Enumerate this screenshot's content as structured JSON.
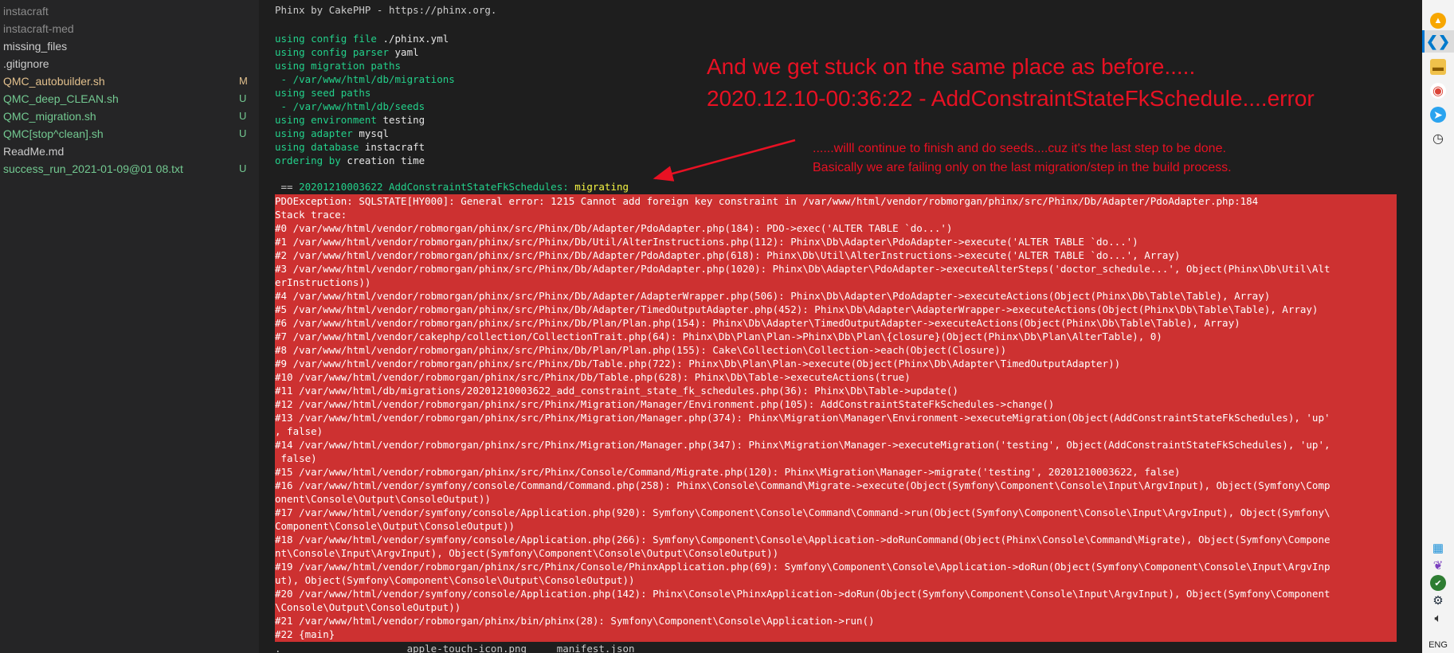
{
  "explorer": {
    "files": [
      {
        "name": "instacraft",
        "badge": "",
        "tone": "dim"
      },
      {
        "name": "instacraft-med",
        "badge": "",
        "tone": "dim"
      },
      {
        "name": "missing_files",
        "badge": "",
        "tone": "white"
      },
      {
        "name": ".gitignore",
        "badge": "",
        "tone": "white"
      },
      {
        "name": "QMC_autobuilder.sh",
        "badge": "M",
        "tone": "modified"
      },
      {
        "name": "QMC_deep_CLEAN.sh",
        "badge": "U",
        "tone": "untracked"
      },
      {
        "name": "QMC_migration.sh",
        "badge": "U",
        "tone": "untracked"
      },
      {
        "name": "QMC[stop^clean].sh",
        "badge": "U",
        "tone": "untracked"
      },
      {
        "name": "ReadMe.md",
        "badge": "",
        "tone": "white"
      },
      {
        "name": "success_run_2021-01-09@01 08.txt",
        "badge": "U",
        "tone": "untracked"
      }
    ]
  },
  "terminal": {
    "header": "Phinx by CakePHP - https://phinx.org.",
    "config_lines": [
      {
        "kw": "using config file",
        "val": " ./phinx.yml"
      },
      {
        "kw": "using config parser",
        "val": " yaml"
      },
      {
        "kw": "using migration paths",
        "val": ""
      },
      {
        "kw": " - /var/www/html/db/migrations",
        "val": ""
      },
      {
        "kw": "using seed paths",
        "val": ""
      },
      {
        "kw": " - /var/www/html/db/seeds",
        "val": ""
      },
      {
        "kw": "using environment",
        "val": " testing"
      },
      {
        "kw": "using adapter",
        "val": " mysql"
      },
      {
        "kw": "using database",
        "val": " instacraft"
      },
      {
        "kw": "ordering by",
        "val": " creation time"
      }
    ],
    "migration_prefix": " == ",
    "migration_name": "20201210003622 AddConstraintStateFkSchedules:",
    "migration_status": " migrating",
    "error_lines": [
      "PDOException: SQLSTATE[HY000]: General error: 1215 Cannot add foreign key constraint in /var/www/html/vendor/robmorgan/phinx/src/Phinx/Db/Adapter/PdoAdapter.php:184",
      "Stack trace:",
      "#0 /var/www/html/vendor/robmorgan/phinx/src/Phinx/Db/Adapter/PdoAdapter.php(184): PDO->exec('ALTER TABLE `do...')",
      "#1 /var/www/html/vendor/robmorgan/phinx/src/Phinx/Db/Util/AlterInstructions.php(112): Phinx\\Db\\Adapter\\PdoAdapter->execute('ALTER TABLE `do...')",
      "#2 /var/www/html/vendor/robmorgan/phinx/src/Phinx/Db/Adapter/PdoAdapter.php(618): Phinx\\Db\\Util\\AlterInstructions->execute('ALTER TABLE `do...', Array)",
      "#3 /var/www/html/vendor/robmorgan/phinx/src/Phinx/Db/Adapter/PdoAdapter.php(1020): Phinx\\Db\\Adapter\\PdoAdapter->executeAlterSteps('doctor_schedule...', Object(Phinx\\Db\\Util\\Alt",
      "erInstructions))",
      "#4 /var/www/html/vendor/robmorgan/phinx/src/Phinx/Db/Adapter/AdapterWrapper.php(506): Phinx\\Db\\Adapter\\PdoAdapter->executeActions(Object(Phinx\\Db\\Table\\Table), Array)",
      "#5 /var/www/html/vendor/robmorgan/phinx/src/Phinx/Db/Adapter/TimedOutputAdapter.php(452): Phinx\\Db\\Adapter\\AdapterWrapper->executeActions(Object(Phinx\\Db\\Table\\Table), Array)",
      "#6 /var/www/html/vendor/robmorgan/phinx/src/Phinx/Db/Plan/Plan.php(154): Phinx\\Db\\Adapter\\TimedOutputAdapter->executeActions(Object(Phinx\\Db\\Table\\Table), Array)",
      "#7 /var/www/html/vendor/cakephp/collection/CollectionTrait.php(64): Phinx\\Db\\Plan\\Plan->Phinx\\Db\\Plan\\{closure}(Object(Phinx\\Db\\Plan\\AlterTable), 0)",
      "#8 /var/www/html/vendor/robmorgan/phinx/src/Phinx/Db/Plan/Plan.php(155): Cake\\Collection\\Collection->each(Object(Closure))",
      "#9 /var/www/html/vendor/robmorgan/phinx/src/Phinx/Db/Table.php(722): Phinx\\Db\\Plan\\Plan->execute(Object(Phinx\\Db\\Adapter\\TimedOutputAdapter))",
      "#10 /var/www/html/vendor/robmorgan/phinx/src/Phinx/Db/Table.php(628): Phinx\\Db\\Table->executeActions(true)",
      "#11 /var/www/html/db/migrations/20201210003622_add_constraint_state_fk_schedules.php(36): Phinx\\Db\\Table->update()",
      "#12 /var/www/html/vendor/robmorgan/phinx/src/Phinx/Migration/Manager/Environment.php(105): AddConstraintStateFkSchedules->change()",
      "#13 /var/www/html/vendor/robmorgan/phinx/src/Phinx/Migration/Manager.php(374): Phinx\\Migration\\Manager\\Environment->executeMigration(Object(AddConstraintStateFkSchedules), 'up'",
      ", false)",
      "#14 /var/www/html/vendor/robmorgan/phinx/src/Phinx/Migration/Manager.php(347): Phinx\\Migration\\Manager->executeMigration('testing', Object(AddConstraintStateFkSchedules), 'up',",
      " false)",
      "#15 /var/www/html/vendor/robmorgan/phinx/src/Phinx/Console/Command/Migrate.php(120): Phinx\\Migration\\Manager->migrate('testing', 20201210003622, false)",
      "#16 /var/www/html/vendor/symfony/console/Command/Command.php(258): Phinx\\Console\\Command\\Migrate->execute(Object(Symfony\\Component\\Console\\Input\\ArgvInput), Object(Symfony\\Comp",
      "onent\\Console\\Output\\ConsoleOutput))",
      "#17 /var/www/html/vendor/symfony/console/Application.php(920): Symfony\\Component\\Console\\Command\\Command->run(Object(Symfony\\Component\\Console\\Input\\ArgvInput), Object(Symfony\\",
      "Component\\Console\\Output\\ConsoleOutput))",
      "#18 /var/www/html/vendor/symfony/console/Application.php(266): Symfony\\Component\\Console\\Application->doRunCommand(Object(Phinx\\Console\\Command\\Migrate), Object(Symfony\\Compone",
      "nt\\Console\\Input\\ArgvInput), Object(Symfony\\Component\\Console\\Output\\ConsoleOutput))",
      "#19 /var/www/html/vendor/robmorgan/phinx/src/Phinx/Console/PhinxApplication.php(69): Symfony\\Component\\Console\\Application->doRun(Object(Symfony\\Component\\Console\\Input\\ArgvInp",
      "ut), Object(Symfony\\Component\\Console\\Output\\ConsoleOutput))",
      "#20 /var/www/html/vendor/symfony/console/Application.php(142): Phinx\\Console\\PhinxApplication->doRun(Object(Symfony\\Component\\Console\\Input\\ArgvInput), Object(Symfony\\Component",
      "\\Console\\Output\\ConsoleOutput))",
      "#21 /var/www/html/vendor/robmorgan/phinx/bin/phinx(28): Symfony\\Component\\Console\\Application->run()",
      "#22 {main}"
    ],
    "footer": ".                     apple-touch-icon.png     manifest.json"
  },
  "annotations": {
    "headline_1": "And we get stuck on the same place as before.....",
    "headline_2": "2020.12.10-00:36:22 - AddConstraintStateFkSchedule....error",
    "note_1": "......willl continue to finish and do seeds....cuz it's the last step to be done.",
    "note_2": "Basically we are failing only on the last migration/step in the build process.",
    "color": "#e81123"
  },
  "tray": {
    "language": "ENG"
  },
  "colors": {
    "terminal_bg": "#1e1e1e",
    "sidebar_bg": "#252526",
    "error_bg": "#cd3131",
    "untracked": "#73c991",
    "modified": "#e2c08d"
  }
}
